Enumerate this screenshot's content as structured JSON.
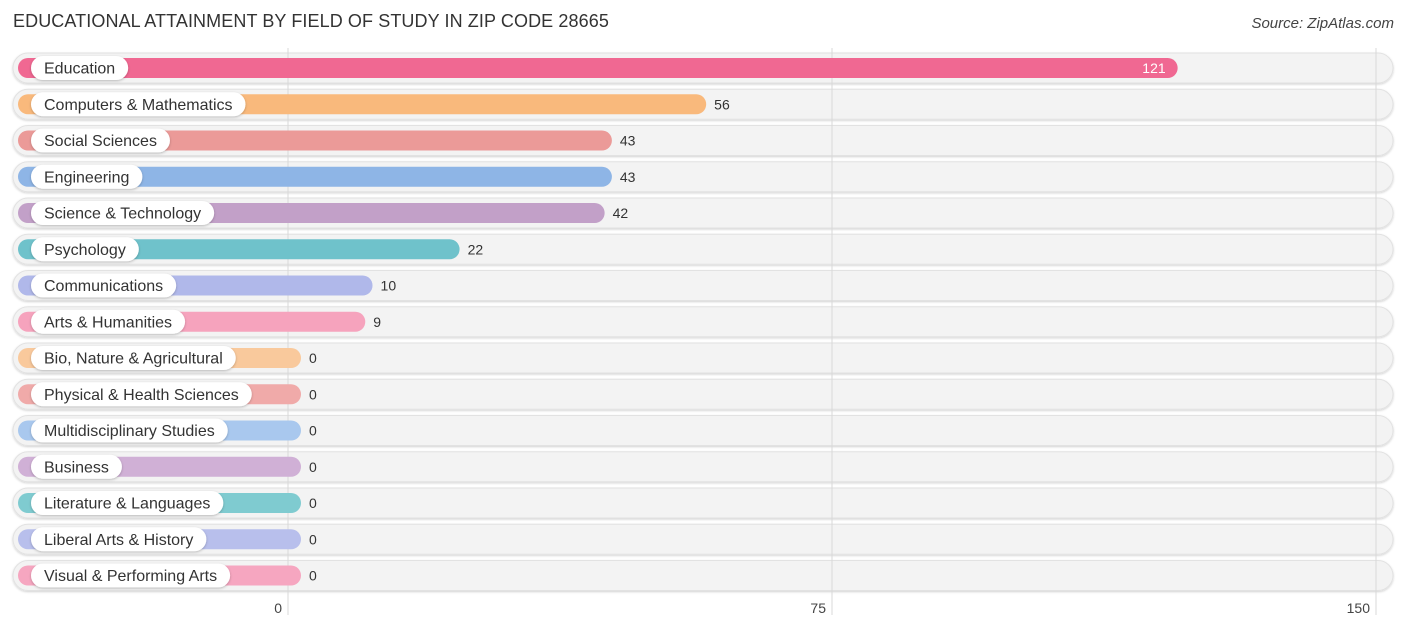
{
  "header": {
    "title": "EDUCATIONAL ATTAINMENT BY FIELD OF STUDY IN ZIP CODE 28665",
    "source": "Source: ZipAtlas.com"
  },
  "chart_data": {
    "type": "bar",
    "orientation": "horizontal",
    "title": "EDUCATIONAL ATTAINMENT BY FIELD OF STUDY IN ZIP CODE 28665",
    "xlabel": "",
    "ylabel": "",
    "xlim": [
      0,
      150
    ],
    "ticks": [
      0,
      75,
      150
    ],
    "tick_labels": [
      "0",
      "75",
      "150"
    ],
    "grid": true,
    "categories": [
      "Education",
      "Computers & Mathematics",
      "Social Sciences",
      "Engineering",
      "Science & Technology",
      "Psychology",
      "Communications",
      "Arts & Humanities",
      "Bio, Nature & Agricultural",
      "Physical & Health Sciences",
      "Multidisciplinary Studies",
      "Business",
      "Literature & Languages",
      "Liberal Arts & History",
      "Visual & Performing Arts"
    ],
    "values": [
      121,
      56,
      43,
      43,
      42,
      22,
      10,
      9,
      0,
      0,
      0,
      0,
      0,
      0,
      0
    ],
    "value_labels": [
      "121",
      "56",
      "43",
      "43",
      "42",
      "22",
      "10",
      "9",
      "0",
      "0",
      "0",
      "0",
      "0",
      "0",
      "0"
    ],
    "colors": [
      "#f06892",
      "#f9b97c",
      "#eb9a98",
      "#8eb5e6",
      "#c2a0c8",
      "#6fc2cb",
      "#b0b8ea",
      "#f6a3bd",
      "#f9c99c",
      "#f0aaa9",
      "#a9c8ee",
      "#d0b0d6",
      "#7fcbd0",
      "#b8bfec",
      "#f6a6c0"
    ]
  }
}
